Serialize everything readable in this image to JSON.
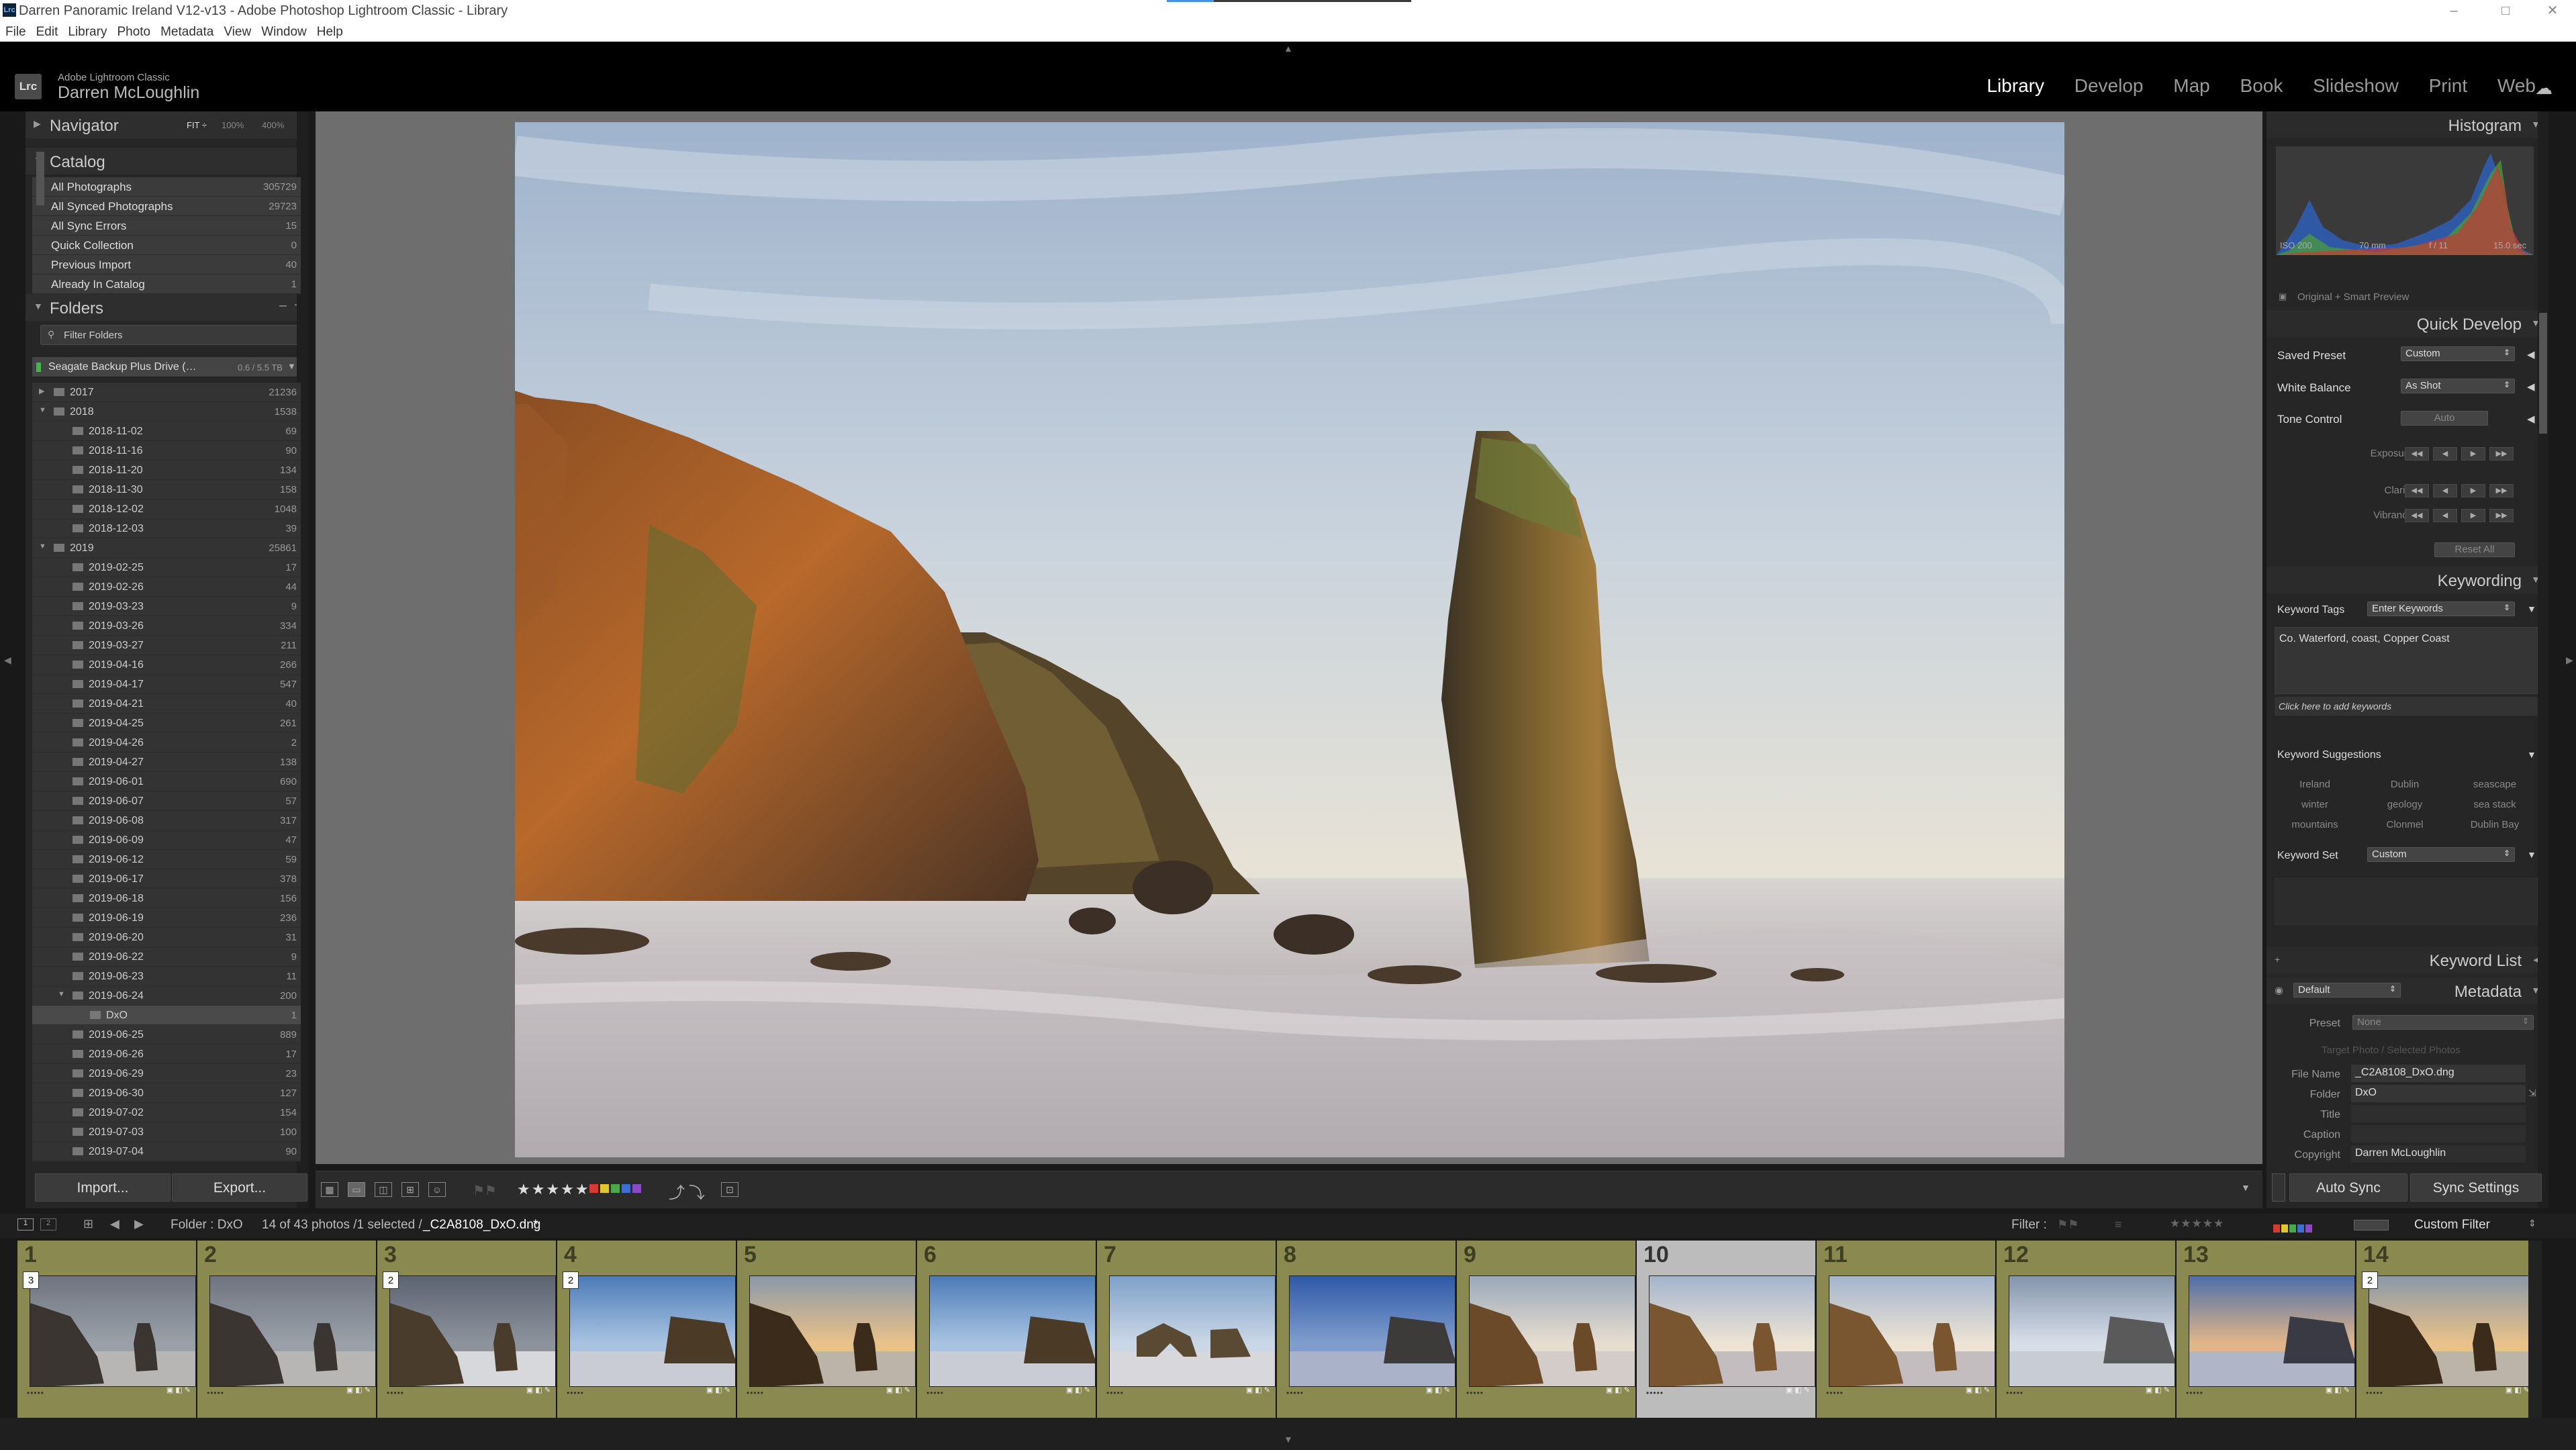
{
  "window": {
    "title": "Darren Panoramic Ireland V12-v13 - Adobe Photoshop Lightroom Classic - Library",
    "minimize": "–",
    "maximize": "□",
    "close": "✕"
  },
  "menu": [
    "File",
    "Edit",
    "Library",
    "Photo",
    "Metadata",
    "View",
    "Window",
    "Help"
  ],
  "identity": {
    "logo": "Lrc",
    "product": "Adobe Lightroom Classic",
    "user": "Darren McLoughlin"
  },
  "modules": [
    "Library",
    "Develop",
    "Map",
    "Book",
    "Slideshow",
    "Print",
    "Web"
  ],
  "active_module": "Library",
  "navigator": {
    "title": "Navigator",
    "zoom": [
      "FIT ÷",
      "100%",
      "400%"
    ]
  },
  "catalog": {
    "title": "Catalog",
    "items": [
      {
        "label": "All Photographs",
        "count": "305729"
      },
      {
        "label": "All Synced Photographs",
        "count": "29723"
      },
      {
        "label": "All Sync Errors",
        "count": "15"
      },
      {
        "label": "Quick Collection",
        "count": "0"
      },
      {
        "label": "Previous Import",
        "count": "40"
      },
      {
        "label": "Already In Catalog",
        "count": "1"
      }
    ]
  },
  "folders": {
    "title": "Folders",
    "filter_placeholder": "Filter Folders",
    "volume": {
      "label": "Seagate Backup Plus Drive (…",
      "size": "0.6 / 5.5 TB"
    },
    "items": [
      {
        "label": "2017",
        "count": "21236",
        "level": 0,
        "expanded": false
      },
      {
        "label": "2018",
        "count": "1538",
        "level": 0,
        "expanded": true
      },
      {
        "label": "2018-11-02",
        "count": "69",
        "level": 1
      },
      {
        "label": "2018-11-16",
        "count": "90",
        "level": 1
      },
      {
        "label": "2018-11-20",
        "count": "134",
        "level": 1
      },
      {
        "label": "2018-11-30",
        "count": "158",
        "level": 1
      },
      {
        "label": "2018-12-02",
        "count": "1048",
        "level": 1
      },
      {
        "label": "2018-12-03",
        "count": "39",
        "level": 1
      },
      {
        "label": "2019",
        "count": "25861",
        "level": 0,
        "expanded": true
      },
      {
        "label": "2019-02-25",
        "count": "17",
        "level": 1
      },
      {
        "label": "2019-02-26",
        "count": "44",
        "level": 1
      },
      {
        "label": "2019-03-23",
        "count": "9",
        "level": 1
      },
      {
        "label": "2019-03-26",
        "count": "334",
        "level": 1
      },
      {
        "label": "2019-03-27",
        "count": "211",
        "level": 1
      },
      {
        "label": "2019-04-16",
        "count": "266",
        "level": 1
      },
      {
        "label": "2019-04-17",
        "count": "547",
        "level": 1
      },
      {
        "label": "2019-04-21",
        "count": "40",
        "level": 1
      },
      {
        "label": "2019-04-25",
        "count": "261",
        "level": 1
      },
      {
        "label": "2019-04-26",
        "count": "2",
        "level": 1
      },
      {
        "label": "2019-04-27",
        "count": "138",
        "level": 1
      },
      {
        "label": "2019-06-01",
        "count": "690",
        "level": 1
      },
      {
        "label": "2019-06-07",
        "count": "57",
        "level": 1
      },
      {
        "label": "2019-06-08",
        "count": "317",
        "level": 1
      },
      {
        "label": "2019-06-09",
        "count": "47",
        "level": 1
      },
      {
        "label": "2019-06-12",
        "count": "59",
        "level": 1
      },
      {
        "label": "2019-06-17",
        "count": "378",
        "level": 1
      },
      {
        "label": "2019-06-18",
        "count": "156",
        "level": 1
      },
      {
        "label": "2019-06-19",
        "count": "236",
        "level": 1
      },
      {
        "label": "2019-06-20",
        "count": "31",
        "level": 1
      },
      {
        "label": "2019-06-22",
        "count": "9",
        "level": 1
      },
      {
        "label": "2019-06-23",
        "count": "11",
        "level": 1
      },
      {
        "label": "2019-06-24",
        "count": "200",
        "level": 1,
        "expanded": true
      },
      {
        "label": "DxO",
        "count": "1",
        "level": 2,
        "selected": true
      },
      {
        "label": "2019-06-25",
        "count": "889",
        "level": 1
      },
      {
        "label": "2019-06-26",
        "count": "17",
        "level": 1
      },
      {
        "label": "2019-06-29",
        "count": "23",
        "level": 1
      },
      {
        "label": "2019-06-30",
        "count": "127",
        "level": 1
      },
      {
        "label": "2019-07-02",
        "count": "154",
        "level": 1
      },
      {
        "label": "2019-07-03",
        "count": "100",
        "level": 1
      },
      {
        "label": "2019-07-04",
        "count": "90",
        "level": 1
      }
    ]
  },
  "left_buttons": {
    "import": "Import...",
    "export": "Export..."
  },
  "histogram": {
    "title": "Histogram",
    "iso": "ISO 200",
    "focal": "70 mm",
    "aperture": "f / 11",
    "shutter": "15.0 sec",
    "preview": "Original + Smart Preview"
  },
  "quick_develop": {
    "title": "Quick Develop",
    "saved_preset_label": "Saved Preset",
    "saved_preset_value": "Custom",
    "white_balance_label": "White Balance",
    "white_balance_value": "As Shot",
    "tone_control_label": "Tone Control",
    "auto_label": "Auto",
    "exposure_label": "Exposure",
    "clarity_label": "Clarity",
    "vibrance_label": "Vibrance",
    "reset_label": "Reset All",
    "btn_glyphs": [
      "◀◀",
      "◀",
      "▶",
      "▶▶"
    ]
  },
  "keywording": {
    "title": "Keywording",
    "tags_label": "Keyword Tags",
    "tags_mode": "Enter Keywords",
    "tags_text": "Co. Waterford, coast, Copper Coast",
    "add_hint": "Click here to add keywords",
    "suggestions_label": "Keyword Suggestions",
    "suggestions": [
      "Ireland",
      "Dublin",
      "seascape",
      "winter",
      "geology",
      "sea stack",
      "mountains",
      "Clonmel",
      "Dublin Bay"
    ],
    "set_label": "Keyword Set",
    "set_value": "Custom"
  },
  "keyword_list": {
    "title": "Keyword List"
  },
  "metadata": {
    "title": "Metadata",
    "view": "Default",
    "preset_label": "Preset",
    "preset_value": "None",
    "target_hint": "Target Photo / Selected Photos",
    "file_name_label": "File Name",
    "file_name": "_C2A8108_DxO.dng",
    "folder_label": "Folder",
    "folder": "DxO",
    "title_label": "Title",
    "caption_label": "Caption",
    "copyright_label": "Copyright",
    "copyright": "Darren McLoughlin"
  },
  "sync": {
    "auto_sync": "Auto Sync",
    "sync_settings": "Sync Settings"
  },
  "toolbar": {
    "stars": "★★★★★",
    "sort_icons": [
      "⤴",
      "⤵"
    ]
  },
  "filmstrip_bar": {
    "pages": [
      "1",
      "2"
    ],
    "source": "Folder : DxO",
    "status": "14 of 43 photos /1 selected /",
    "file": "_C2A8108_DxO.dng",
    "file_suffix": "*",
    "filter_label": "Filter :",
    "filter_stars": "★★★★★",
    "custom_filter": "Custom Filter"
  },
  "filmstrip": [
    {
      "num": "1",
      "stack": "3",
      "scene": "dark"
    },
    {
      "num": "2",
      "stack": "",
      "scene": "dark"
    },
    {
      "num": "3",
      "stack": "2",
      "scene": "storm"
    },
    {
      "num": "4",
      "stack": "2",
      "scene": "blue"
    },
    {
      "num": "5",
      "stack": "",
      "scene": "golden"
    },
    {
      "num": "6",
      "stack": "",
      "scene": "blue"
    },
    {
      "num": "7",
      "stack": "",
      "scene": "arch"
    },
    {
      "num": "8",
      "stack": "",
      "scene": "deepblue"
    },
    {
      "num": "9",
      "stack": "",
      "scene": "calm"
    },
    {
      "num": "10",
      "stack": "",
      "scene": "main",
      "selected": true
    },
    {
      "num": "11",
      "stack": "",
      "scene": "main"
    },
    {
      "num": "12",
      "stack": "",
      "scene": "cloudy"
    },
    {
      "num": "13",
      "stack": "",
      "scene": "sunset"
    },
    {
      "num": "14",
      "stack": "2",
      "scene": "golden"
    }
  ],
  "colors": {
    "accent": "#ffffff",
    "panel": "#262626",
    "filmstrip_cell": "#8a8a50",
    "filmstrip_selected": "#bcbcbc",
    "label_red": "#d53b32",
    "label_yellow": "#e0c632",
    "label_green": "#4aa84a",
    "label_blue": "#3e6fd0",
    "label_purple": "#8a4ac4"
  }
}
